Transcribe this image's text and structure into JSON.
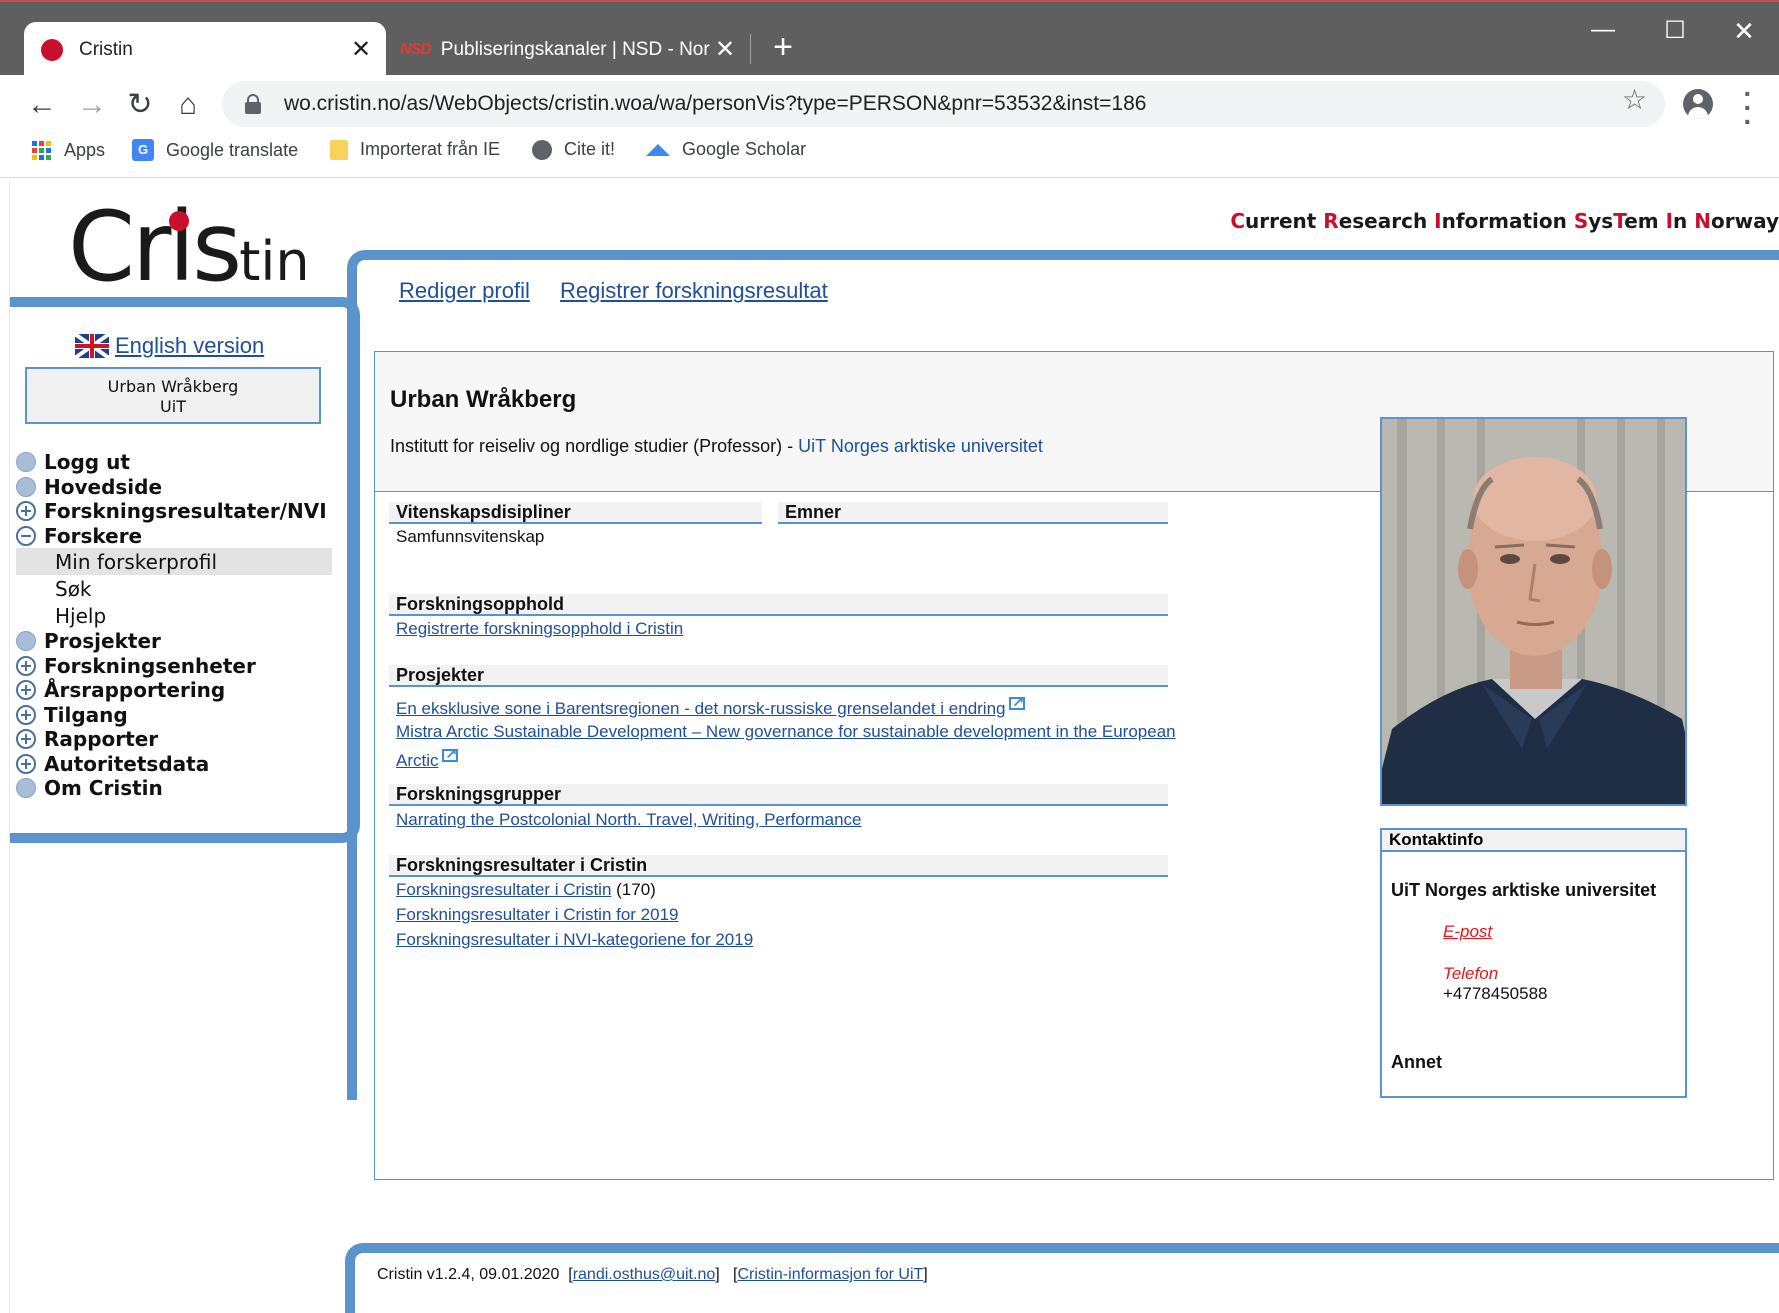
{
  "browser": {
    "tabs": [
      {
        "title": "Cristin",
        "active": true
      },
      {
        "title": "Publiseringskanaler | NSD - Norsk",
        "favicon_text": "NSD",
        "active": false
      }
    ],
    "url": "wo.cristin.no/as/WebObjects/cristin.woa/wa/personVis?type=PERSON&pnr=53532&inst=186",
    "bookmarks": [
      {
        "label": "Apps",
        "icon": "apps-grid-icon"
      },
      {
        "label": "Google translate",
        "icon": "google-translate-icon"
      },
      {
        "label": "Importerat från IE",
        "icon": "folder-icon"
      },
      {
        "label": "Cite it!",
        "icon": "globe-icon"
      },
      {
        "label": "Google Scholar",
        "icon": "google-scholar-icon"
      }
    ]
  },
  "header": {
    "logo_main": "Cris",
    "logo_tail": "tin",
    "tagline": [
      {
        "t": "C",
        "r": true
      },
      {
        "t": "urrent ",
        "r": false
      },
      {
        "t": "R",
        "r": true
      },
      {
        "t": "esearch ",
        "r": false
      },
      {
        "t": "I",
        "r": true
      },
      {
        "t": "nformation ",
        "r": false
      },
      {
        "t": "S",
        "r": true
      },
      {
        "t": "ys",
        "r": false
      },
      {
        "t": "T",
        "r": true
      },
      {
        "t": "em ",
        "r": false
      },
      {
        "t": "I",
        "r": true
      },
      {
        "t": "n ",
        "r": false
      },
      {
        "t": "N",
        "r": true
      },
      {
        "t": "orway",
        "r": false
      }
    ]
  },
  "sidebar": {
    "english_link": "English version",
    "user_name": "Urban Wråkberg",
    "user_inst": "UiT",
    "menu": [
      {
        "label": "Logg ut",
        "mark": "disc",
        "name": "menu-logg-ut"
      },
      {
        "label": "Hovedside",
        "mark": "disc",
        "name": "menu-hovedside"
      },
      {
        "label": "Forskningsresultater/NVI",
        "mark": "plus",
        "name": "menu-forskningsresultater-nvi"
      },
      {
        "label": "Forskere",
        "mark": "minus",
        "name": "menu-forskere"
      },
      {
        "label": "Min forskerprofil",
        "mark": "sub",
        "active": true,
        "name": "menu-min-forskerprofil"
      },
      {
        "label": "Søk",
        "mark": "sub",
        "name": "menu-sok"
      },
      {
        "label": "Hjelp",
        "mark": "sub",
        "name": "menu-hjelp"
      },
      {
        "label": "Prosjekter",
        "mark": "disc",
        "name": "menu-prosjekter"
      },
      {
        "label": "Forskningsenheter",
        "mark": "plus",
        "name": "menu-forskningsenheter"
      },
      {
        "label": "Årsrapportering",
        "mark": "plus",
        "name": "menu-arsrapportering"
      },
      {
        "label": "Tilgang",
        "mark": "plus",
        "name": "menu-tilgang"
      },
      {
        "label": "Rapporter",
        "mark": "plus",
        "name": "menu-rapporter"
      },
      {
        "label": "Autoritetsdata",
        "mark": "plus",
        "name": "menu-autoritetsdata"
      },
      {
        "label": "Om Cristin",
        "mark": "disc",
        "name": "menu-om-cristin"
      }
    ]
  },
  "main": {
    "top_links": [
      "Rediger profil",
      "Registrer forskningsresultat"
    ],
    "person_name": "Urban Wråkberg",
    "affiliation_text": "Institutt for reiseliv og nordlige studier (Professor) - ",
    "affiliation_link": "UiT Norges arktiske universitet",
    "sections": {
      "disipliner_h": "Vitenskapsdisipliner",
      "disipliner_value": "Samfunnsvitenskap",
      "emner_h": "Emner",
      "opphold_h": "Forskningsopphold",
      "opphold_link": "Registrerte forskningsopphold i Cristin",
      "prosjekter_h": "Prosjekter",
      "prosjekt_1": "En eksklusive sone i Barentsregionen - det norsk-russiske grenselandet i endring",
      "prosjekt_2_line1": "Mistra Arctic Sustainable Development – New governance for sustainable development in the European",
      "prosjekt_2_line2": "Arctic",
      "grupper_h": "Forskningsgrupper",
      "gruppe_1": "Narrating the Postcolonial North. Travel, Writing, Performance",
      "resultater_h": "Forskningsresultater i Cristin",
      "resultat_1": "Forskningsresultater i Cristin",
      "resultat_1_count": "(170)",
      "resultat_2": "Forskningsresultater i Cristin for  2019",
      "resultat_3": "Forskningsresultater i NVI-kategoriene for  2019"
    },
    "kontakt": {
      "heading": "Kontaktinfo",
      "institution": "UiT Norges arktiske universitet",
      "email_label": "E-post",
      "phone_label": "Telefon",
      "phone": "+4778450588",
      "annet": "Annet"
    }
  },
  "footer": {
    "version": "Cristin v1.2.4, 09.01.2020",
    "email": "randi.osthus@uit.no",
    "info_link": "Cristin-informasjon for UiT"
  }
}
